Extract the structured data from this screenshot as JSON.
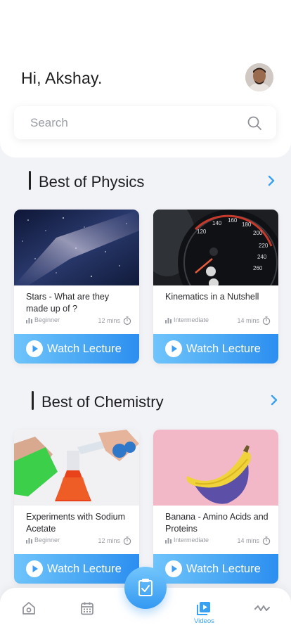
{
  "header": {
    "greeting": "Hi, Akshay."
  },
  "search": {
    "placeholder": "Search"
  },
  "sections": [
    {
      "title": "Best of Physics",
      "cards": [
        {
          "title": "Stars - What are they made up of ?",
          "level": "Beginner",
          "duration": "12 mins",
          "button": "Watch Lecture",
          "thumb": "galaxy-night-sky"
        },
        {
          "title": "Kinematics in a Nutshell",
          "level": "Intermediate",
          "duration": "14 mins",
          "button": "Watch Lecture",
          "thumb": "speedometer"
        }
      ]
    },
    {
      "title": "Best of Chemistry",
      "cards": [
        {
          "title": "Experiments with Sodium Acetate",
          "level": "Beginner",
          "duration": "12 mins",
          "button": "Watch Lecture",
          "thumb": "lab-flasks"
        },
        {
          "title": "Banana - Amino Acids and Proteins",
          "level": "Intermediate",
          "duration": "14 mins",
          "button": "Watch Lecture",
          "thumb": "banana-on-pink"
        }
      ]
    }
  ],
  "nav": {
    "items": [
      "home-icon",
      "calendar-icon",
      "clipboard-icon",
      "videos-icon",
      "activity-icon"
    ],
    "active_label": "Videos"
  },
  "colors": {
    "accent": "#39a1f2",
    "background": "#f2f3f7"
  }
}
